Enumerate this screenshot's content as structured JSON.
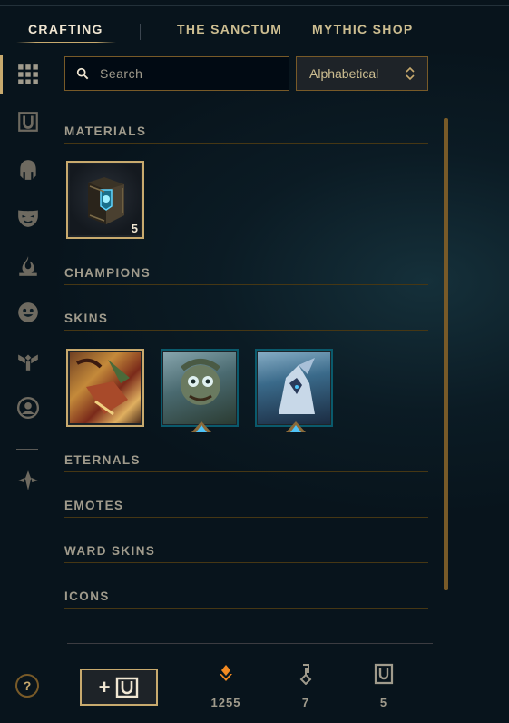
{
  "tabs": [
    {
      "label": "CRAFTING",
      "active": true
    },
    {
      "label": "THE SANCTUM",
      "active": false
    },
    {
      "label": "MYTHIC SHOP",
      "active": false
    }
  ],
  "sidebar": {
    "icons": [
      "grid-icon",
      "chest-icon",
      "helmet-icon",
      "mask-icon",
      "flame-icon",
      "emote-icon",
      "ward-icon",
      "profile-icon",
      "eternals-icon"
    ]
  },
  "search": {
    "placeholder": "Search"
  },
  "sort": {
    "value": "Alphabetical"
  },
  "sections": {
    "materials": "MATERIALS",
    "champions": "CHAMPIONS",
    "skins": "SKINS",
    "eternals": "ETERNALS",
    "emotes": "EMOTES",
    "ward_skins": "WARD SKINS",
    "icons": "ICONS"
  },
  "materials": [
    {
      "name": "chest",
      "count": "5"
    }
  ],
  "skins": [
    {
      "name": "skin-shard-1"
    },
    {
      "name": "skin-shard-2"
    },
    {
      "name": "skin-shard-3"
    }
  ],
  "footer": {
    "help": "?",
    "add_button": "+",
    "orange_essence": "1255",
    "keys": "7",
    "chests": "5"
  },
  "colors": {
    "gold": "#c8aa6e",
    "dark_gold": "#785a28",
    "teal": "#0a5a6c",
    "bg": "#0b1b24",
    "orange": "#f28a22"
  }
}
